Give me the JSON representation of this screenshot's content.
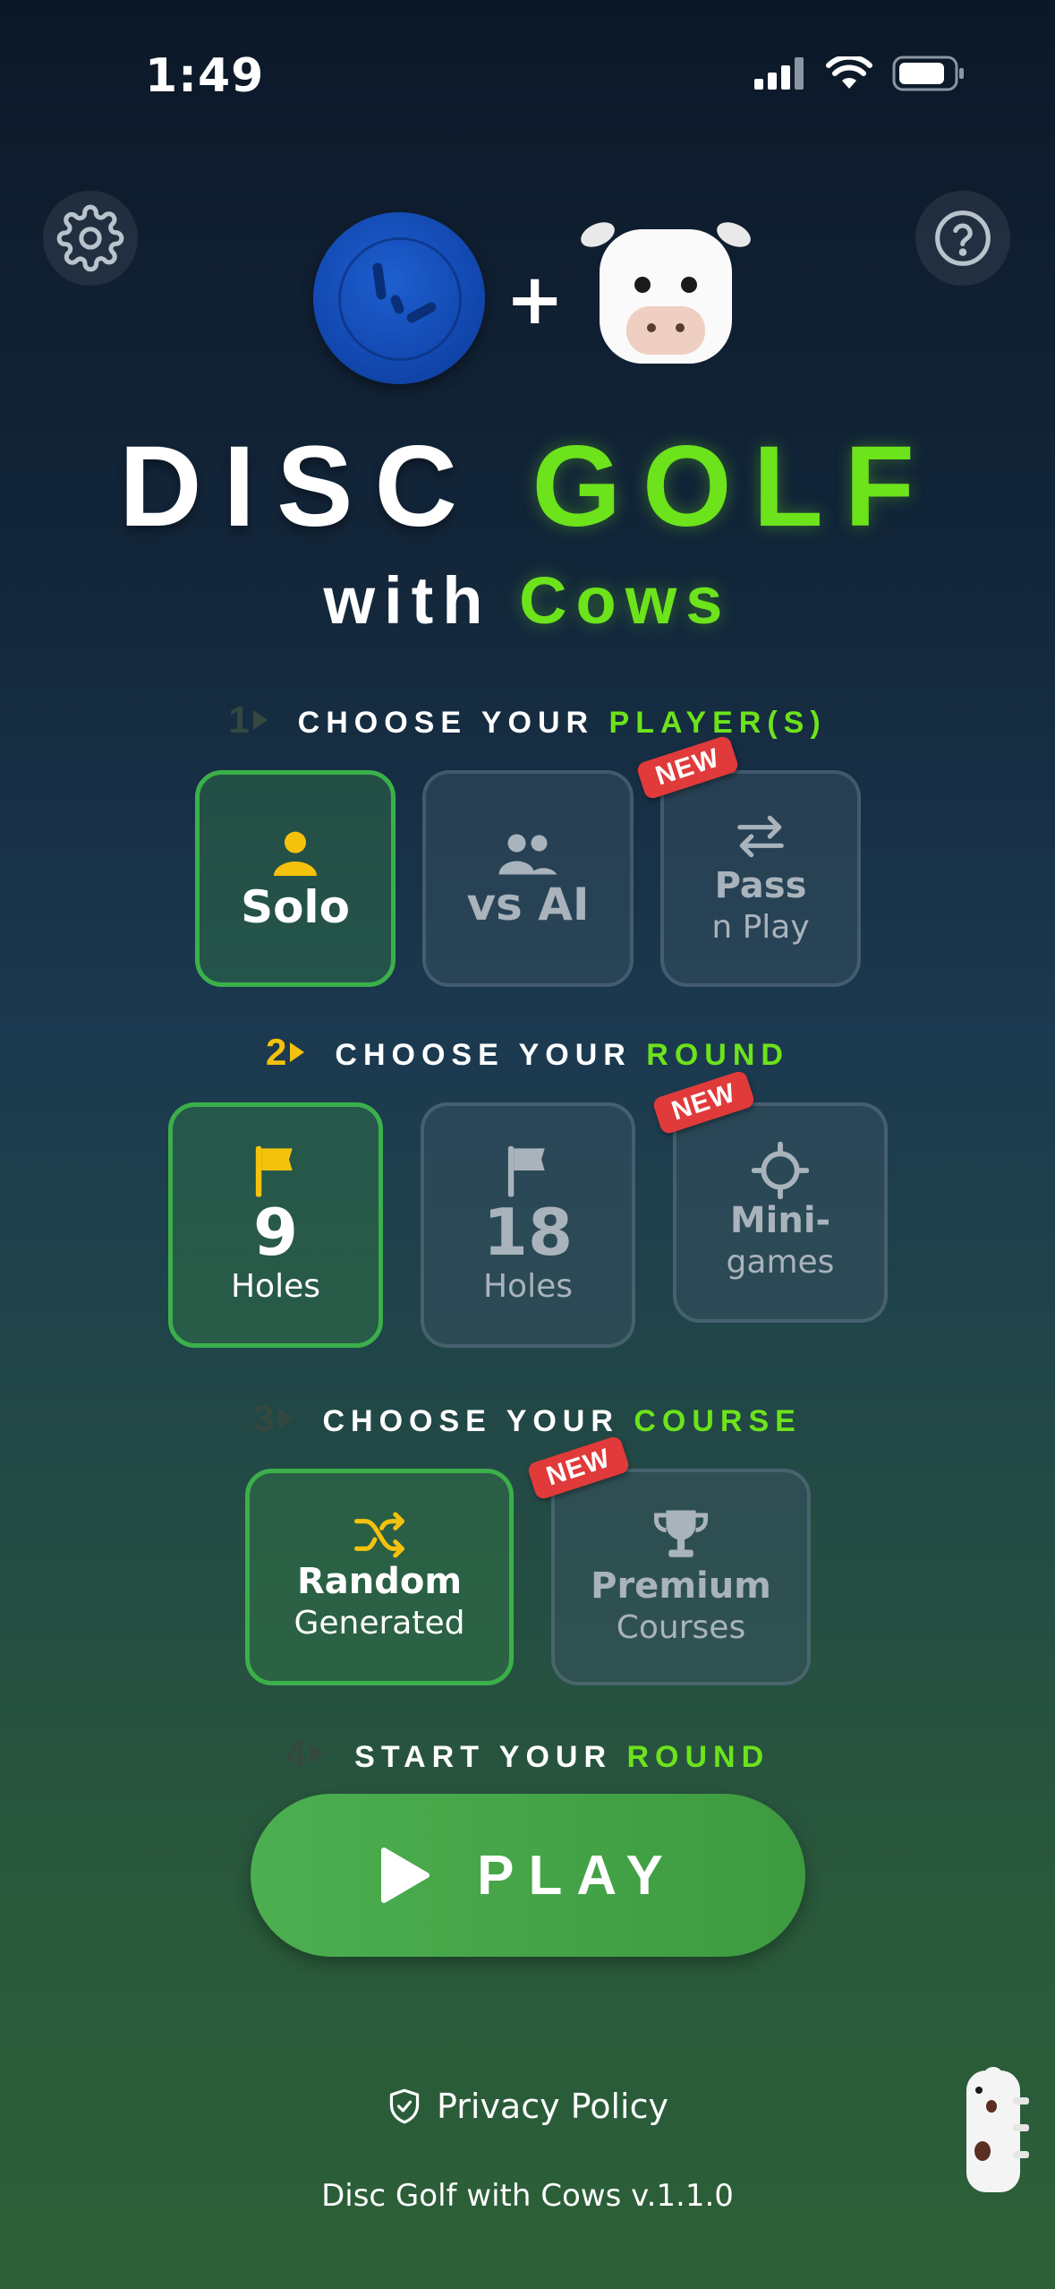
{
  "status_bar": {
    "time": "1:49"
  },
  "header": {
    "settings_icon": "gear-icon",
    "help_icon": "question-circle-icon",
    "logo_plus": "+"
  },
  "title": {
    "part1": "DISC",
    "part2": "GOLF",
    "sub1": "with",
    "sub2": "Cows"
  },
  "steps": [
    {
      "num": "1",
      "text": "CHOOSE YOUR",
      "accent": "PLAYER(S)"
    },
    {
      "num": "2",
      "text": "CHOOSE YOUR",
      "accent": "ROUND"
    },
    {
      "num": "3",
      "text": "CHOOSE YOUR",
      "accent": "COURSE"
    },
    {
      "num": "4",
      "text": "START YOUR",
      "accent": "ROUND"
    }
  ],
  "players": [
    {
      "label": "Solo",
      "selected": true,
      "icon": "person-icon"
    },
    {
      "label": "vs AI",
      "selected": false,
      "icon": "users-icon"
    },
    {
      "label": "Pass",
      "sub": "n Play",
      "selected": false,
      "icon": "swap-arrows-icon",
      "badge": "NEW"
    }
  ],
  "rounds": [
    {
      "value": "9",
      "sub": "Holes",
      "selected": true,
      "icon": "flag-icon"
    },
    {
      "value": "18",
      "sub": "Holes",
      "selected": false,
      "icon": "flag-icon"
    },
    {
      "label": "Mini-",
      "sub": "games",
      "selected": false,
      "icon": "crosshair-icon",
      "badge": "NEW"
    }
  ],
  "courses": [
    {
      "label": "Random",
      "sub": "Generated",
      "selected": true,
      "icon": "shuffle-icon"
    },
    {
      "label": "Premium",
      "sub": "Courses",
      "selected": false,
      "icon": "trophy-icon",
      "badge": "NEW"
    }
  ],
  "play": {
    "label": "PLAY"
  },
  "footer": {
    "privacy": "Privacy Policy",
    "version": "Disc Golf with Cows v.1.1.0"
  },
  "colors": {
    "accent_green": "#6de31b",
    "selected_border": "#3bb04a",
    "yellow": "#f4c20d",
    "badge_red": "#e03a3a"
  }
}
